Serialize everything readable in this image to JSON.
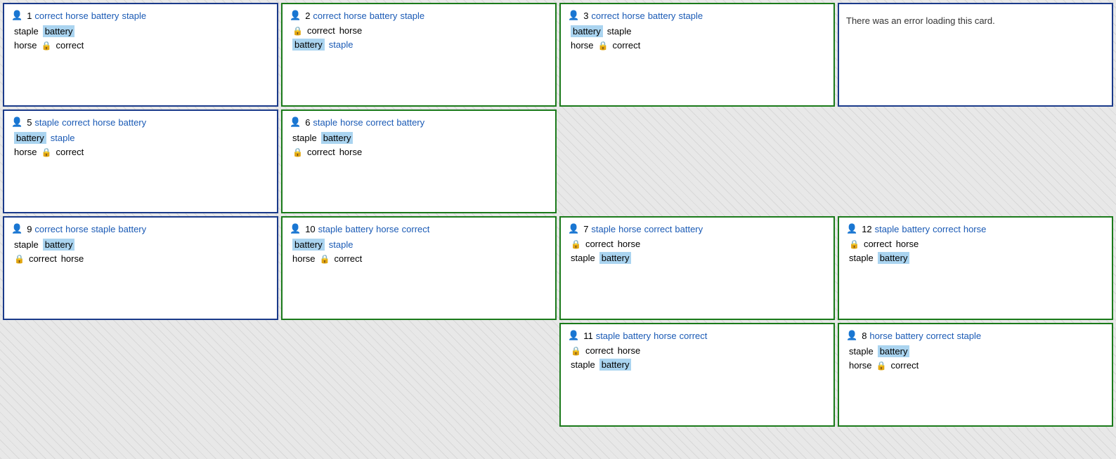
{
  "cards": [
    {
      "id": 1,
      "pos": 1,
      "green_border": false,
      "header": {
        "number": "1",
        "words": [
          "correct",
          "horse",
          "battery",
          "staple"
        ]
      },
      "rows": [
        [
          {
            "text": "staple",
            "style": "plain"
          },
          {
            "text": "battery",
            "style": "highlight"
          }
        ],
        [
          {
            "text": "horse",
            "style": "plain"
          },
          {
            "icon": "lock"
          },
          {
            "text": "correct",
            "style": "plain"
          }
        ]
      ]
    },
    {
      "id": 2,
      "pos": 2,
      "green_border": true,
      "header": {
        "number": "2",
        "words": [
          "correct",
          "horse",
          "battery",
          "staple"
        ]
      },
      "rows": [
        [
          {
            "icon": "lock"
          },
          {
            "text": "correct",
            "style": "plain"
          },
          {
            "text": "horse",
            "style": "plain"
          }
        ],
        [
          {
            "text": "battery",
            "style": "highlight"
          },
          {
            "text": "staple",
            "style": "blue"
          }
        ]
      ]
    },
    {
      "id": 3,
      "pos": 3,
      "green_border": true,
      "header": {
        "number": "3",
        "words": [
          "correct",
          "horse",
          "battery",
          "staple"
        ]
      },
      "rows": [
        [
          {
            "text": "battery",
            "style": "highlight"
          },
          {
            "text": "staple",
            "style": "plain"
          }
        ],
        [
          {
            "text": "horse",
            "style": "plain"
          },
          {
            "icon": "lock"
          },
          {
            "text": "correct",
            "style": "plain"
          }
        ]
      ]
    },
    {
      "id": "error",
      "pos": 4,
      "green_border": false,
      "error": true,
      "error_text": "There was an error loading this card."
    },
    {
      "id": 5,
      "pos": 5,
      "green_border": false,
      "header": {
        "number": "5",
        "words": [
          "staple",
          "correct",
          "horse",
          "battery"
        ]
      },
      "rows": [
        [
          {
            "text": "battery",
            "style": "highlight"
          },
          {
            "text": "staple",
            "style": "blue"
          }
        ],
        [
          {
            "text": "horse",
            "style": "plain"
          },
          {
            "icon": "lock"
          },
          {
            "text": "correct",
            "style": "plain"
          }
        ]
      ]
    },
    {
      "id": 6,
      "pos": 6,
      "green_border": true,
      "header": {
        "number": "6",
        "words": [
          "staple",
          "horse",
          "correct",
          "battery"
        ]
      },
      "rows": [
        [
          {
            "text": "staple",
            "style": "plain"
          },
          {
            "text": "battery",
            "style": "highlight"
          }
        ],
        [
          {
            "icon": "lock"
          },
          {
            "text": "correct",
            "style": "plain"
          },
          {
            "text": "horse",
            "style": "plain"
          }
        ]
      ]
    },
    {
      "id": 9,
      "pos": 9,
      "green_border": false,
      "header": {
        "number": "9",
        "words": [
          "correct",
          "horse",
          "staple",
          "battery"
        ]
      },
      "rows": [
        [
          {
            "text": "staple",
            "style": "plain"
          },
          {
            "text": "battery",
            "style": "highlight"
          }
        ],
        [
          {
            "icon": "lock"
          },
          {
            "text": "correct",
            "style": "plain"
          },
          {
            "text": "horse",
            "style": "plain"
          }
        ]
      ]
    },
    {
      "id": 10,
      "pos": 10,
      "green_border": true,
      "header": {
        "number": "10",
        "words": [
          "staple",
          "battery",
          "horse",
          "correct"
        ]
      },
      "rows": [
        [
          {
            "text": "battery",
            "style": "highlight"
          },
          {
            "text": "staple",
            "style": "blue"
          }
        ],
        [
          {
            "text": "horse",
            "style": "plain"
          },
          {
            "icon": "lock"
          },
          {
            "text": "correct",
            "style": "plain"
          }
        ]
      ]
    },
    {
      "id": 7,
      "pos": 7,
      "green_border": true,
      "header": {
        "number": "7",
        "words": [
          "staple",
          "horse",
          "correct",
          "battery"
        ]
      },
      "rows": [
        [
          {
            "icon": "lock"
          },
          {
            "text": "correct",
            "style": "plain"
          },
          {
            "text": "horse",
            "style": "plain"
          }
        ],
        [
          {
            "text": "staple",
            "style": "plain"
          },
          {
            "text": "battery",
            "style": "highlight"
          }
        ]
      ]
    },
    {
      "id": 12,
      "pos": 12,
      "green_border": true,
      "header": {
        "number": "12",
        "words": [
          "staple",
          "battery",
          "correct",
          "horse"
        ]
      },
      "rows": [
        [
          {
            "icon": "lock"
          },
          {
            "text": "correct",
            "style": "plain"
          },
          {
            "text": "horse",
            "style": "plain"
          }
        ],
        [
          {
            "text": "staple",
            "style": "plain"
          },
          {
            "text": "battery",
            "style": "highlight"
          }
        ]
      ]
    },
    {
      "id": 11,
      "pos": 11,
      "green_border": true,
      "header": {
        "number": "11",
        "words": [
          "staple",
          "battery",
          "horse",
          "correct"
        ]
      },
      "rows": [
        [
          {
            "icon": "lock"
          },
          {
            "text": "correct",
            "style": "plain"
          },
          {
            "text": "horse",
            "style": "plain"
          }
        ],
        [
          {
            "text": "staple",
            "style": "plain"
          },
          {
            "text": "battery",
            "style": "highlight"
          }
        ]
      ]
    },
    {
      "id": 8,
      "pos": 8,
      "green_border": true,
      "header": {
        "number": "8",
        "words": [
          "horse",
          "battery",
          "correct",
          "staple"
        ]
      },
      "rows": [
        [
          {
            "text": "staple",
            "style": "plain"
          },
          {
            "text": "battery",
            "style": "highlight"
          }
        ],
        [
          {
            "text": "horse",
            "style": "plain"
          },
          {
            "icon": "lock"
          },
          {
            "text": "correct",
            "style": "plain"
          }
        ]
      ]
    }
  ]
}
